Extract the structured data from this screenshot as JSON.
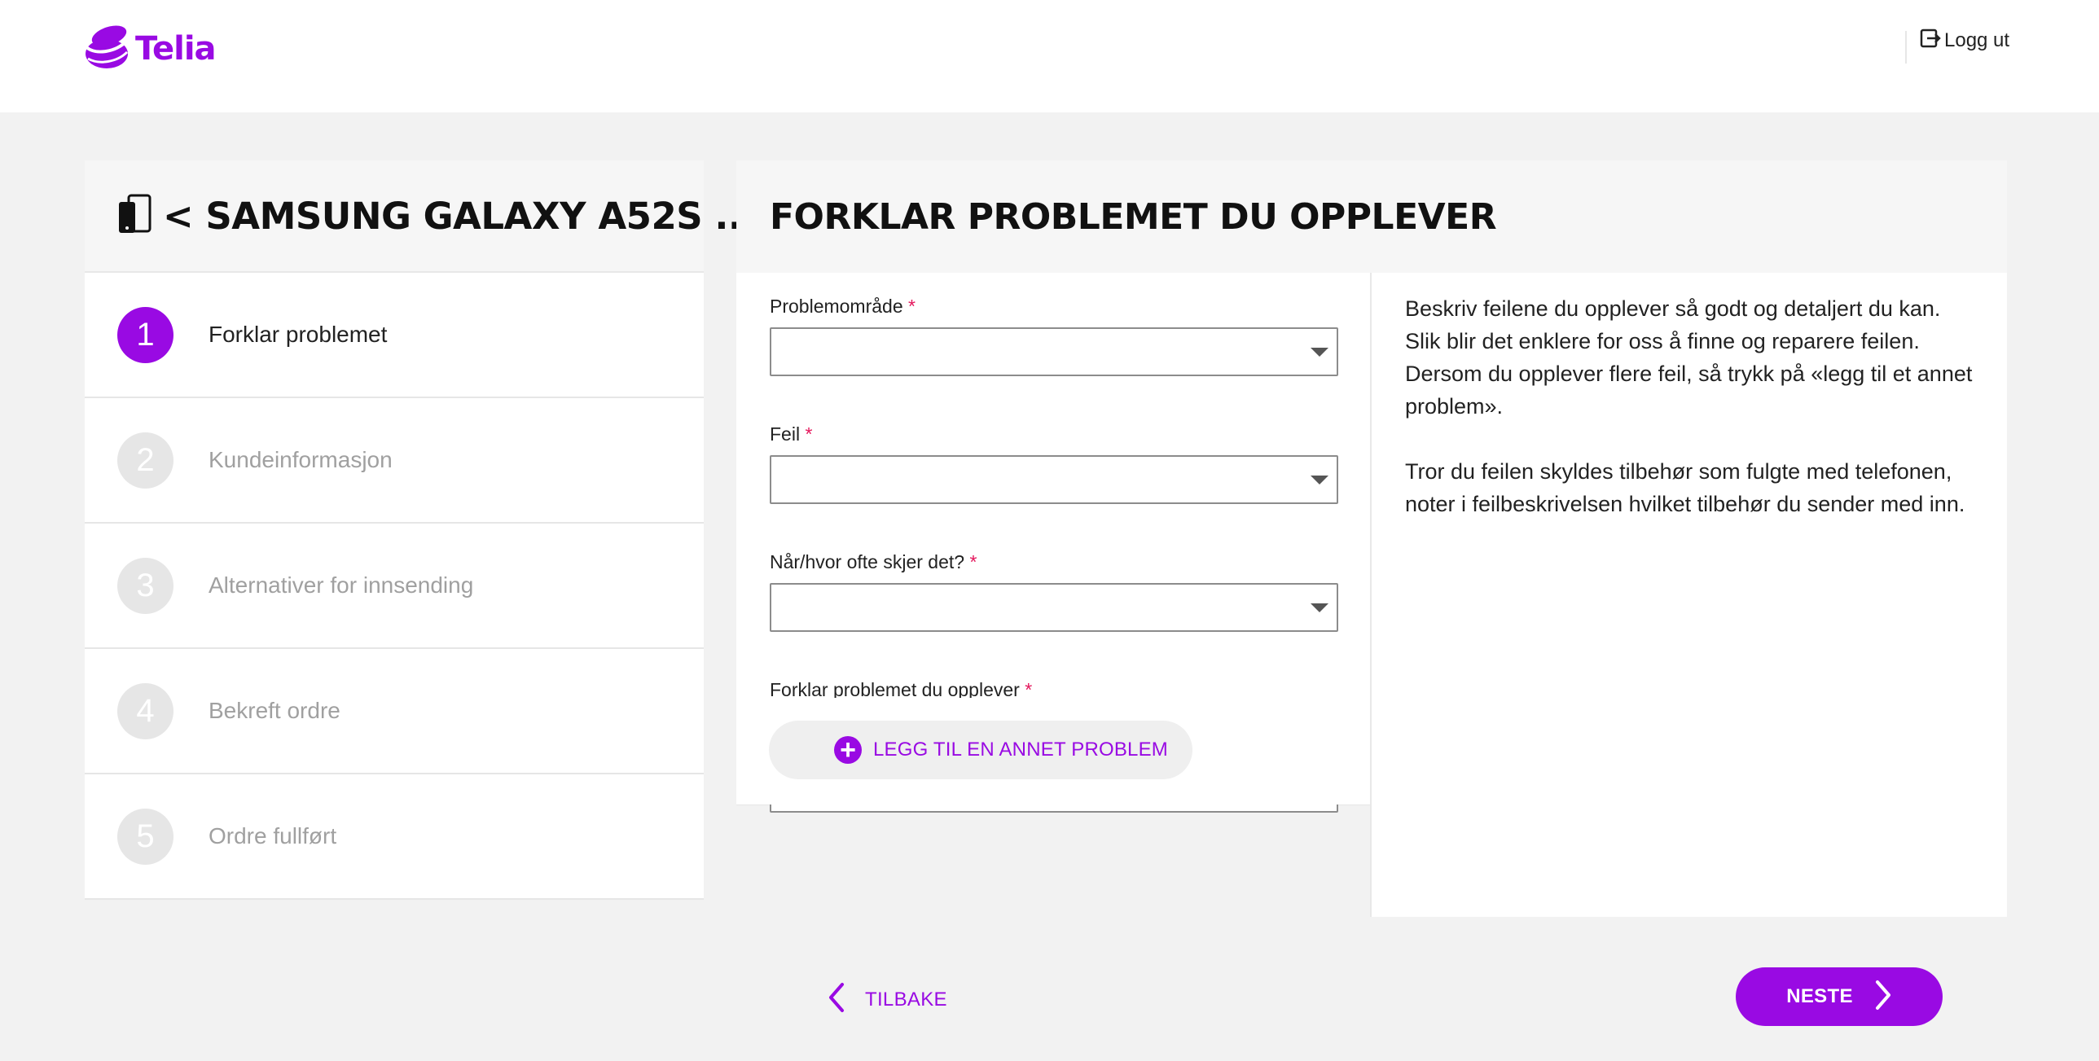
{
  "header": {
    "logo_text": "Telia",
    "logout_label": "Logg ut",
    "brand_color": "#990ae3"
  },
  "stepper": {
    "title": "< SAMSUNG GALAXY A52S ...",
    "steps": [
      {
        "number": "1",
        "label": "Forklar problemet",
        "active": true
      },
      {
        "number": "2",
        "label": "Kundeinformasjon",
        "active": false
      },
      {
        "number": "3",
        "label": "Alternativer for innsending",
        "active": false
      },
      {
        "number": "4",
        "label": "Bekreft ordre",
        "active": false
      },
      {
        "number": "5",
        "label": "Ordre fullført",
        "active": false
      }
    ]
  },
  "main": {
    "title": "FORKLAR PROBLEMET DU OPPLEVER",
    "form": {
      "problem_area_label": "Problemområde",
      "problem_area_value": "",
      "error_label": "Feil",
      "error_value": "",
      "frequency_label": "Når/hvor ofte skjer det?",
      "frequency_value": "",
      "description_label": "Forklar problemet du opplever",
      "description_value": "",
      "required_marker": "*"
    },
    "add_problem_label": "LEGG TIL EN ANNET PROBLEM",
    "info": {
      "paragraph_1": "Beskriv feilene du opplever så godt og detaljert du kan. Slik blir det enklere for oss å finne og reparere feilen. Dersom du opplever flere feil, så trykk på «legg til et annet problem».",
      "paragraph_2": "Tror du feilen skyldes tilbehør som fulgte med telefonen, noter i feilbeskrivelsen hvilket tilbehør du sender med inn."
    },
    "back_label": "TILBAKE",
    "next_label": "NESTE"
  }
}
